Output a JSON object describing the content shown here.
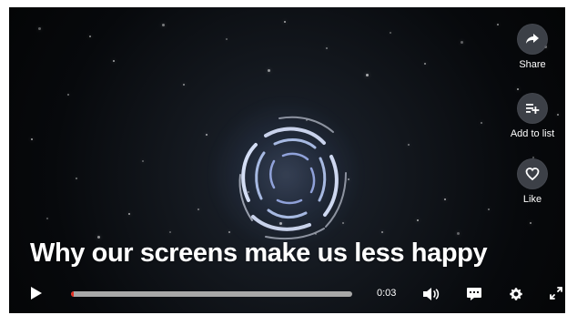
{
  "video": {
    "title": "Why our screens make us less happy",
    "colors": {
      "background": "#05070a",
      "progress_track": "#a8a8a8",
      "progress_fill": "#e62b1e",
      "text": "#ffffff",
      "action_circle": "#464a52"
    }
  },
  "side_actions": [
    {
      "label": "Share",
      "icon": "share-icon"
    },
    {
      "label": "Add to list",
      "icon": "add-to-list-icon"
    },
    {
      "label": "Like",
      "icon": "heart-icon"
    }
  ],
  "controls": {
    "time": "0:03",
    "progress_fraction": 0.01,
    "icons": {
      "play": "play-icon",
      "volume": "volume-icon",
      "captions": "captions-icon",
      "settings": "settings-gear-icon",
      "fullscreen": "fullscreen-icon"
    }
  }
}
